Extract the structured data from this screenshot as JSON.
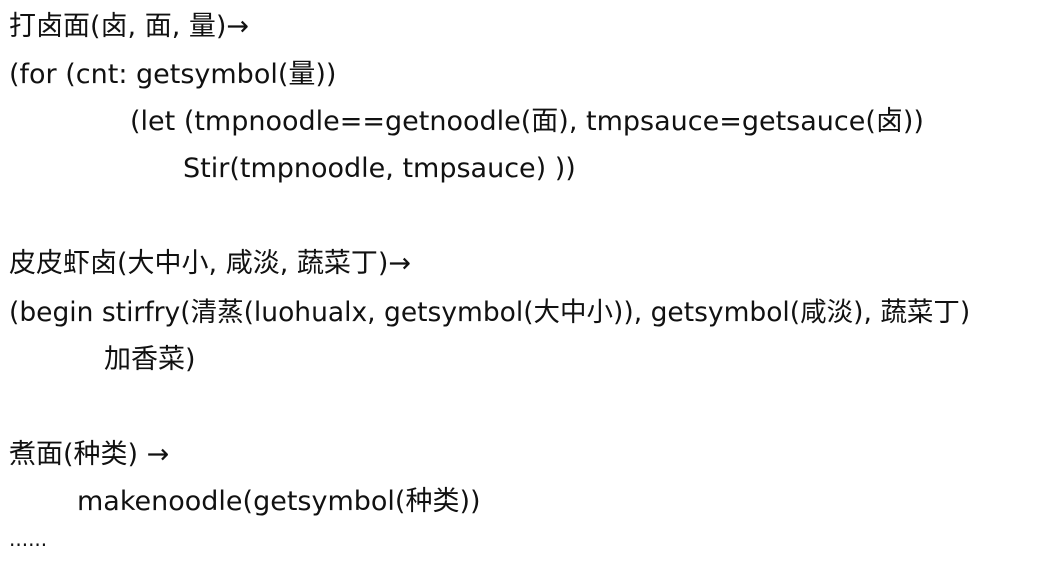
{
  "lines": [
    "打卤面(卤, 面, 量)→",
    "(for (cnt: getsymbol(量))",
    "(let (tmpnoodle==getnoodle(面), tmpsauce=getsauce(卤))",
    "Stir(tmpnoodle, tmpsauce) ))",
    "皮皮虾卤(大中小, 咸淡, 蔬菜丁)→",
    "(begin stirfry(清蒸(luohualx, getsymbol(大中小)), getsymbol(咸淡), 蔬菜丁)",
    "加香菜)",
    "煮面(种类) →",
    "makenoodle(getsymbol(种类))",
    "......"
  ]
}
